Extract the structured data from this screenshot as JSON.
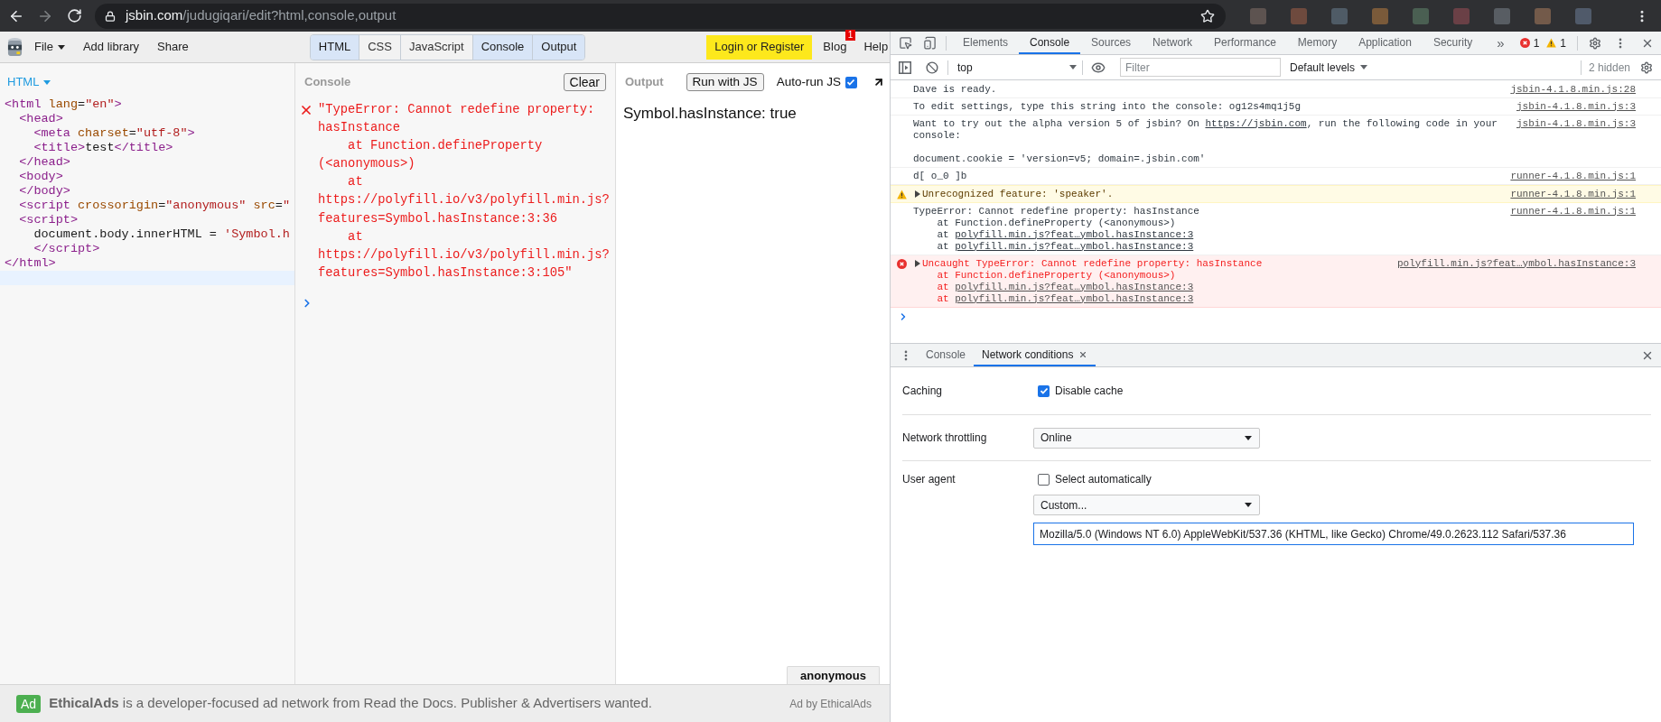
{
  "browser": {
    "url_host": "jsbin.com",
    "url_path": "/judugiqari/edit?html,console,output"
  },
  "jsbin_toolbar": {
    "menu": [
      {
        "label": "File",
        "kind": "dropdown"
      },
      {
        "label": "Add library",
        "kind": "link"
      },
      {
        "label": "Share",
        "kind": "link"
      }
    ],
    "panel_tabs": [
      {
        "label": "HTML",
        "selected": true
      },
      {
        "label": "CSS",
        "selected": false
      },
      {
        "label": "JavaScript",
        "selected": false
      },
      {
        "label": "Console",
        "selected": true
      },
      {
        "label": "Output",
        "selected": true
      }
    ],
    "login": "Login or Register",
    "blog": {
      "label": "Blog",
      "badge": "1"
    },
    "help": "Help"
  },
  "html_panel": {
    "title": "HTML",
    "lines": [
      {
        "active": false,
        "tokens": [
          {
            "kind": "tag",
            "text": "<html"
          },
          {
            "kind": "attr",
            "text": " lang"
          },
          {
            "kind": "plain",
            "text": "="
          },
          {
            "kind": "string",
            "text": "\"en\""
          },
          {
            "kind": "tag",
            "text": ">"
          }
        ]
      },
      {
        "active": false,
        "tokens": [
          {
            "kind": "tag",
            "text": "  <head>"
          }
        ]
      },
      {
        "active": false,
        "tokens": [
          {
            "kind": "tag",
            "text": "    <meta"
          },
          {
            "kind": "attr",
            "text": " charset"
          },
          {
            "kind": "plain",
            "text": "="
          },
          {
            "kind": "string",
            "text": "\"utf-8\""
          },
          {
            "kind": "tag",
            "text": ">"
          }
        ]
      },
      {
        "active": false,
        "tokens": [
          {
            "kind": "tag",
            "text": "    <title>"
          },
          {
            "kind": "plain",
            "text": "test"
          },
          {
            "kind": "tag",
            "text": "</title>"
          }
        ]
      },
      {
        "active": false,
        "tokens": [
          {
            "kind": "tag",
            "text": "  </head>"
          }
        ]
      },
      {
        "active": false,
        "tokens": [
          {
            "kind": "tag",
            "text": "  <body>"
          }
        ]
      },
      {
        "active": false,
        "tokens": [
          {
            "kind": "tag",
            "text": "  </body>"
          }
        ]
      },
      {
        "active": false,
        "tokens": [
          {
            "kind": "tag",
            "text": "  <script"
          },
          {
            "kind": "attr",
            "text": " crossorigin"
          },
          {
            "kind": "plain",
            "text": "="
          },
          {
            "kind": "string",
            "text": "\"anonymous\""
          },
          {
            "kind": "attr",
            "text": " src"
          },
          {
            "kind": "plain",
            "text": "="
          },
          {
            "kind": "string",
            "text": "\""
          }
        ]
      },
      {
        "active": false,
        "tokens": [
          {
            "kind": "tag",
            "text": "  <script>"
          }
        ]
      },
      {
        "active": false,
        "tokens": [
          {
            "kind": "plain",
            "text": "    document.body.innerHTML = "
          },
          {
            "kind": "string",
            "text": "'Symbol.h"
          }
        ]
      },
      {
        "active": false,
        "tokens": [
          {
            "kind": "tag",
            "text": "    </script>"
          }
        ]
      },
      {
        "active": false,
        "tokens": [
          {
            "kind": "tag",
            "text": "</html>"
          }
        ]
      },
      {
        "active": true
      }
    ]
  },
  "console_panel": {
    "title": "Console",
    "clear": "Clear",
    "error_lines": [
      "\"TypeError: Cannot redefine property:",
      "hasInstance",
      "    at Function.defineProperty",
      "(<anonymous>)",
      "    at",
      "https://polyfill.io/v3/polyfill.min.js?",
      "features=Symbol.hasInstance:3:36",
      "    at",
      "https://polyfill.io/v3/polyfill.min.js?",
      "features=Symbol.hasInstance:3:105\""
    ]
  },
  "output_panel": {
    "title": "Output",
    "run": "Run with JS",
    "autorun": {
      "label": "Auto-run JS",
      "checked": true
    },
    "result": "Symbol.hasInstance: true",
    "tooltip": "anonymous"
  },
  "ad_bar": {
    "badge": "Ad",
    "text": "**EthicalAds** is a developer-focused ad network from Read the Docs. Publisher & Advertisers wanted.",
    "credit": "Ad by EthicalAds"
  },
  "devtools": {
    "tabs": [
      {
        "label": "Elements",
        "selected": false
      },
      {
        "label": "Console",
        "selected": true
      },
      {
        "label": "Sources",
        "selected": false
      },
      {
        "label": "Network",
        "selected": false
      },
      {
        "label": "Performance",
        "selected": false
      },
      {
        "label": "Memory",
        "selected": false
      },
      {
        "label": "Application",
        "selected": false
      },
      {
        "label": "Security",
        "selected": false
      }
    ],
    "overflow": "»",
    "error_count": "1",
    "warning_count": "1",
    "console_toolbar": {
      "context": "top",
      "filter_placeholder": "Filter",
      "levels": "Default levels",
      "hidden": "2 hidden"
    },
    "messages": [
      {
        "kind": "log",
        "parts": [
          {
            "text": "Dave is ready.",
            "link": false
          }
        ],
        "source": "jsbin-4.1.8.min.js:28"
      },
      {
        "kind": "log",
        "parts": [
          {
            "text": "To edit settings, type this string into the console: og12s4mq1j5g",
            "link": false
          }
        ],
        "source": "jsbin-4.1.8.min.js:3"
      },
      {
        "kind": "log",
        "parts": [
          {
            "text": "Want to try out the alpha version 5 of jsbin? On ",
            "link": false
          },
          {
            "text": "https://jsbin.com",
            "link": true
          },
          {
            "text": ", run the following code in your\nconsole:\n\ndocument.cookie = 'version=v5; domain=.jsbin.com'",
            "link": false
          }
        ],
        "source": "jsbin-4.1.8.min.js:3"
      },
      {
        "kind": "log",
        "parts": [
          {
            "text": "d[ o_0 ]b",
            "link": false
          }
        ],
        "source": "runner-4.1.8.min.js:1"
      },
      {
        "kind": "warning",
        "expanded": false,
        "parts": [
          {
            "text": "Unrecognized feature: 'speaker'.",
            "link": false
          }
        ],
        "source": "runner-4.1.8.min.js:1"
      },
      {
        "kind": "log",
        "parts": [
          {
            "text": "TypeError: Cannot redefine property: hasInstance\n    at Function.defineProperty (<anonymous>)\n    at ",
            "link": false
          },
          {
            "text": "polyfill.min.js?feat…ymbol.hasInstance:3",
            "link": true
          },
          {
            "text": "\n    at ",
            "link": false
          },
          {
            "text": "polyfill.min.js?feat…ymbol.hasInstance:3",
            "link": true
          }
        ],
        "source": "runner-4.1.8.min.js:1"
      },
      {
        "kind": "error",
        "expanded": false,
        "parts": [
          {
            "text": "Uncaught TypeError: Cannot redefine property: hasInstance\n    at Function.defineProperty (<anonymous>)\n    at ",
            "link": false
          },
          {
            "text": "polyfill.min.js?feat…ymbol.hasInstance:3",
            "link": true
          },
          {
            "text": "\n    at ",
            "link": false
          },
          {
            "text": "polyfill.min.js?feat…ymbol.hasInstance:3",
            "link": true
          }
        ],
        "source": "polyfill.min.js?feat…ymbol.hasInstance:3"
      }
    ],
    "drawer": {
      "tabs": [
        {
          "label": "Console",
          "selected": false,
          "closable": false
        },
        {
          "label": "Network conditions",
          "selected": true,
          "closable": true
        }
      ],
      "caching": {
        "label": "Caching",
        "option": "Disable cache",
        "checked": true
      },
      "throttling": {
        "label": "Network throttling",
        "value": "Online"
      },
      "user_agent": {
        "label": "User agent",
        "option": "Select automatically",
        "checked": false,
        "preset": "Custom...",
        "value": "Mozilla/5.0 (Windows NT 6.0) AppleWebKit/537.36 (KHTML, like Gecko) Chrome/49.0.2623.112 Safari/537.36"
      }
    }
  }
}
